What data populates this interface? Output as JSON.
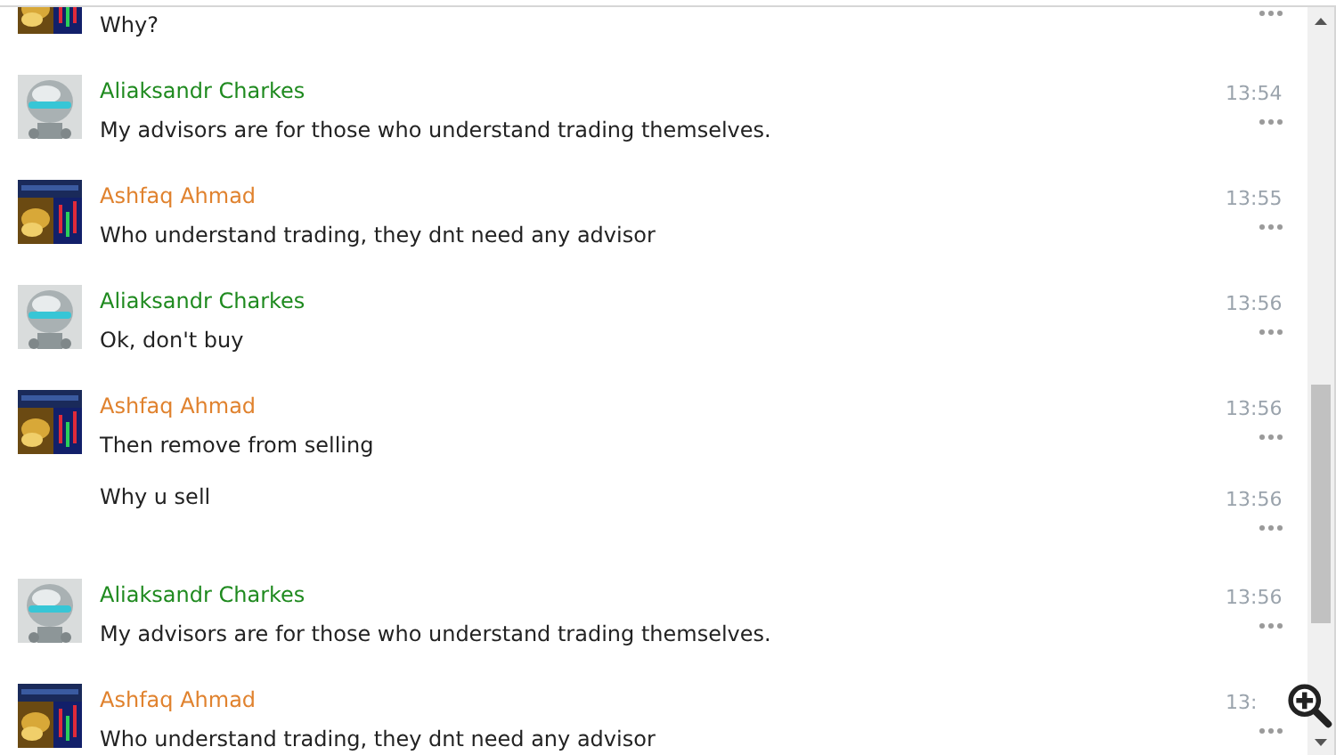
{
  "messages": [
    {
      "kind": "message",
      "text": "Why?"
    },
    {
      "kind": "message",
      "author": "Aliaksandr Charkes",
      "color": "#1f8a1f",
      "time": "13:54",
      "text": "My advisors are for those who understand trading themselves."
    },
    {
      "kind": "message",
      "author": "Ashfaq Ahmad",
      "color": "#e0822e",
      "time": "13:55",
      "text": "Who understand trading, they dnt need any advisor"
    },
    {
      "kind": "message",
      "author": "Aliaksandr Charkes",
      "color": "#1f8a1f",
      "time": "13:56",
      "text": "Ok, don't buy"
    },
    {
      "kind": "message",
      "author": "Ashfaq Ahmad",
      "color": "#e0822e",
      "time": "13:56",
      "text": "Then remove from selling"
    },
    {
      "kind": "continuation",
      "time": "13:56",
      "text": "Why u sell"
    },
    {
      "kind": "message",
      "author": "Aliaksandr Charkes",
      "color": "#1f8a1f",
      "time": "13:56",
      "text": "My advisors are for those who understand trading themselves."
    },
    {
      "kind": "message",
      "author": "Ashfaq Ahmad",
      "color": "#e0822e",
      "time": "13:",
      "text": "Who understand trading, they dnt need any advisor"
    }
  ]
}
